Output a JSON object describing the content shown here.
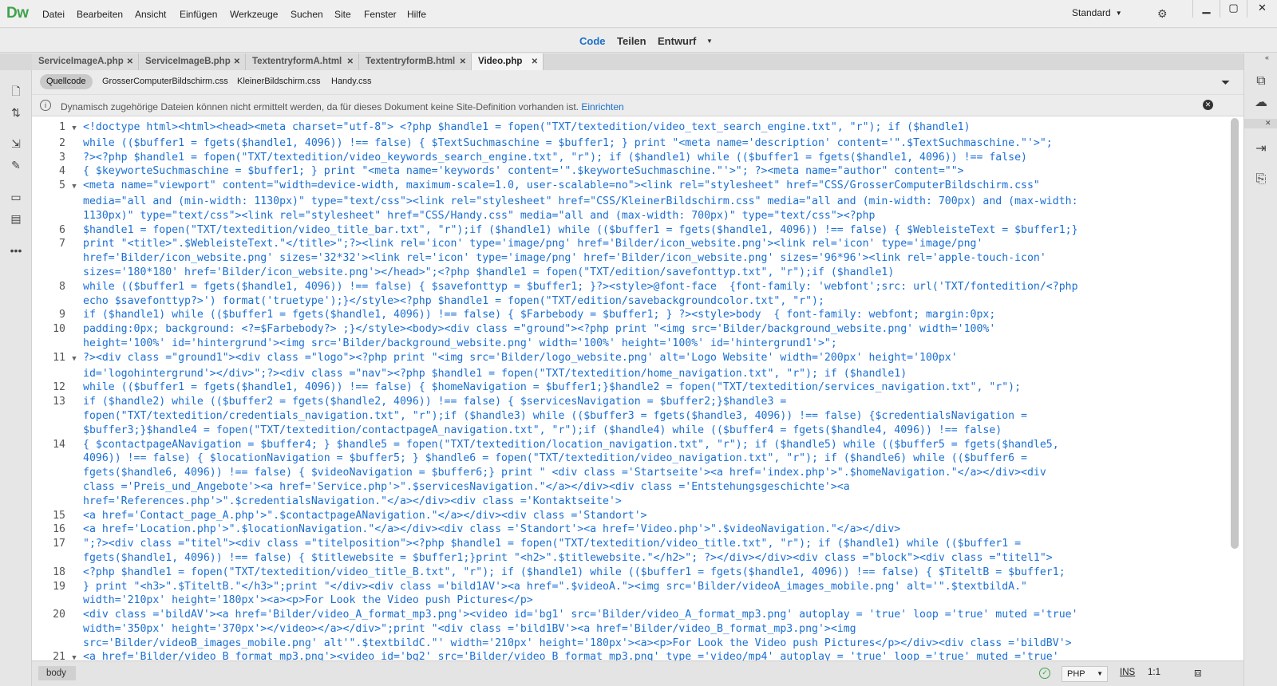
{
  "app": {
    "logo": "Dw"
  },
  "menu": [
    "Datei",
    "Bearbeiten",
    "Ansicht",
    "Einfügen",
    "Werkzeuge",
    "Suchen",
    "Site",
    "Fenster",
    "Hilfe"
  ],
  "workspace": {
    "label": "Standard"
  },
  "window_controls": {
    "minimize": "▁",
    "maximize": "▢",
    "close": "✕"
  },
  "views": {
    "code": "Code",
    "split": "Teilen",
    "design": "Entwurf"
  },
  "doc_tabs": [
    "ServiceImageA.php",
    "ServiceImageB.php",
    "TextentryformA.html",
    "TextentryformB.html",
    "Video.php"
  ],
  "related_files": {
    "source": "Quellcode",
    "files": [
      "GrosserComputerBildschirm.css",
      "KleinerBildschirm.css",
      "Handy.css"
    ]
  },
  "info": {
    "text": "Dynamisch zugehörige Dateien können nicht ermittelt werden, da für dieses Dokument keine Site-Definition vorhanden ist.",
    "link": "Einrichten"
  },
  "code_lines": [
    {
      "n": "1",
      "fold": true,
      "text": "<!doctype html><html><head><meta charset=\"utf-8\"> <?php $handle1 = fopen(\"TXT/textedition/video_text_search_engine.txt\", \"r\"); if ($handle1)"
    },
    {
      "n": "2",
      "fold": false,
      "text": "while (($buffer1 = fgets($handle1, 4096)) !== false) { $TextSuchmaschine = $buffer1; } print \"<meta name='description' content='\".$TextSuchmaschine.\"'>\";"
    },
    {
      "n": "3",
      "fold": false,
      "text": "?><?php $handle1 = fopen(\"TXT/textedition/video_keywords_search_engine.txt\", \"r\"); if ($handle1) while (($buffer1 = fgets($handle1, 4096)) !== false)"
    },
    {
      "n": "4",
      "fold": false,
      "text": "{ $keyworteSuchmaschine = $buffer1; } print \"<meta name='keywords' content='\".$keyworteSuchmaschine.\"'>\"; ?><meta name=\"author\" content=\"\">"
    },
    {
      "n": "5",
      "fold": true,
      "text": "<meta name=\"viewport\" content=\"width=device-width, maximum-scale=1.0, user-scalable=no\"><link rel=\"stylesheet\" href=\"CSS/GrosserComputerBildschirm.css\""
    },
    {
      "n": "",
      "fold": false,
      "text": "media=\"all and (min-width: 1130px)\" type=\"text/css\"><link rel=\"stylesheet\" href=\"CSS/KleinerBildschirm.css\" media=\"all and (min-width: 700px) and (max-width:"
    },
    {
      "n": "",
      "fold": false,
      "text": "1130px)\" type=\"text/css\"><link rel=\"stylesheet\" href=\"CSS/Handy.css\" media=\"all and (max-width: 700px)\" type=\"text/css\"><?php"
    },
    {
      "n": "6",
      "fold": false,
      "text": "$handle1 = fopen(\"TXT/textedition/video_title_bar.txt\", \"r\");if ($handle1) while (($buffer1 = fgets($handle1, 4096)) !== false) { $WebleisteText = $buffer1;}"
    },
    {
      "n": "7",
      "fold": false,
      "text": "print \"<title>\".$WebleisteText.\"</title>\";?><link rel='icon' type='image/png' href='Bilder/icon_website.png'><link rel='icon' type='image/png'"
    },
    {
      "n": "",
      "fold": false,
      "text": "href='Bilder/icon_website.png' sizes='32*32'><link rel='icon' type='image/png' href='Bilder/icon_website.png' sizes='96*96'><link rel='apple-touch-icon'"
    },
    {
      "n": "",
      "fold": false,
      "text": "sizes='180*180' href='Bilder/icon_website.png'></head>\";<?php $handle1 = fopen(\"TXT/edition/savefonttyp.txt\", \"r\");if ($handle1)"
    },
    {
      "n": "8",
      "fold": false,
      "text": "while (($buffer1 = fgets($handle1, 4096)) !== false) { $savefonttyp = $buffer1; }?><style>@font-face  {font-family: 'webfont';src: url('TXT/fontedition/<?php"
    },
    {
      "n": "",
      "fold": false,
      "text": "echo $savefonttyp?>') format('truetype');}</style><?php $handle1 = fopen(\"TXT/edition/savebackgroundcolor.txt\", \"r\");"
    },
    {
      "n": "9",
      "fold": false,
      "text": "if ($handle1) while (($buffer1 = fgets($handle1, 4096)) !== false) { $Farbebody = $buffer1; } ?><style>body  { font-family: webfont; margin:0px;"
    },
    {
      "n": "10",
      "fold": false,
      "text": "padding:0px; background: <?=$Farbebody?> ;}</style><body><div class =\"ground\"><?php print \"<img src='Bilder/background_website.png' width='100%'"
    },
    {
      "n": "",
      "fold": false,
      "text": "height='100%' id='hintergrund'><img src='Bilder/background_website.png' width='100%' height='100%' id='hintergrund1'>\";"
    },
    {
      "n": "11",
      "fold": true,
      "text": "?><div class =\"ground1\"><div class =\"logo\"><?php print \"<img src='Bilder/logo_website.png' alt='Logo Website' width='200px' height='100px'"
    },
    {
      "n": "",
      "fold": false,
      "text": "id='logohintergrund'></div>\";?><div class =\"nav\"><?php $handle1 = fopen(\"TXT/textedition/home_navigation.txt\", \"r\"); if ($handle1)"
    },
    {
      "n": "12",
      "fold": false,
      "text": "while (($buffer1 = fgets($handle1, 4096)) !== false) { $homeNavigation = $buffer1;}$handle2 = fopen(\"TXT/textedition/services_navigation.txt\", \"r\");"
    },
    {
      "n": "13",
      "fold": false,
      "text": "if ($handle2) while (($buffer2 = fgets($handle2, 4096)) !== false) { $servicesNavigation = $buffer2;}$handle3 ="
    },
    {
      "n": "",
      "fold": false,
      "text": "fopen(\"TXT/textedition/credentials_navigation.txt\", \"r\");if ($handle3) while (($buffer3 = fgets($handle3, 4096)) !== false) {$credentialsNavigation ="
    },
    {
      "n": "",
      "fold": false,
      "text": "$buffer3;}$handle4 = fopen(\"TXT/textedition/contactpageA_navigation.txt\", \"r\");if ($handle4) while (($buffer4 = fgets($handle4, 4096)) !== false)"
    },
    {
      "n": "14",
      "fold": false,
      "text": "{ $contactpageANavigation = $buffer4; } $handle5 = fopen(\"TXT/textedition/location_navigation.txt\", \"r\"); if ($handle5) while (($buffer5 = fgets($handle5,"
    },
    {
      "n": "",
      "fold": false,
      "text": "4096)) !== false) { $locationNavigation = $buffer5; } $handle6 = fopen(\"TXT/textedition/video_navigation.txt\", \"r\"); if ($handle6) while (($buffer6 ="
    },
    {
      "n": "",
      "fold": false,
      "text": "fgets($handle6, 4096)) !== false) { $videoNavigation = $buffer6;} print \" <div class ='Startseite'><a href='index.php'>\".$homeNavigation.\"</a></div><div"
    },
    {
      "n": "",
      "fold": false,
      "text": "class ='Preis_und_Angebote'><a href='Service.php'>\".$servicesNavigation.\"</a></div><div class ='Entstehungsgeschichte'><a"
    },
    {
      "n": "",
      "fold": false,
      "text": "href='References.php'>\".$credentialsNavigation.\"</a></div><div class ='Kontaktseite'>"
    },
    {
      "n": "15",
      "fold": false,
      "text": "<a href='Contact_page_A.php'>\".$contactpageANavigation.\"</a></div><div class ='Standort'>"
    },
    {
      "n": "16",
      "fold": false,
      "text": "<a href='Location.php'>\".$locationNavigation.\"</a></div><div class ='Standort'><a href='Video.php'>\".$videoNavigation.\"</a></div>"
    },
    {
      "n": "17",
      "fold": false,
      "text": "\";?><div class =\"titel\"><div class =\"titelposition\"><?php $handle1 = fopen(\"TXT/textedition/video_title.txt\", \"r\"); if ($handle1) while (($buffer1 ="
    },
    {
      "n": "",
      "fold": false,
      "text": "fgets($handle1, 4096)) !== false) { $titlewebsite = $buffer1;}print \"<h2>\".$titlewebsite.\"</h2>\"; ?></div></div><div class =\"block\"><div class =\"titel1\">"
    },
    {
      "n": "18",
      "fold": false,
      "text": "<?php $handle1 = fopen(\"TXT/textedition/video_title_B.txt\", \"r\"); if ($handle1) while (($buffer1 = fgets($handle1, 4096)) !== false) { $TiteltB = $buffer1;"
    },
    {
      "n": "19",
      "fold": false,
      "text": "} print \"<h3>\".$TiteltB.\"</h3>\";print \"</div><div class ='bild1AV'><a href=\".$videoA.\"><img src='Bilder/videoA_images_mobile.png' alt='\".$textbildA.\""
    },
    {
      "n": "",
      "fold": false,
      "text": "width='210px' height='180px'><a><p>For Look the Video push Pictures</p>"
    },
    {
      "n": "20",
      "fold": false,
      "text": "<div class ='bildAV'><a href='Bilder/video_A_format_mp3.png'><video id='bg1' src='Bilder/video_A_format_mp3.png' autoplay = 'true' loop ='true' muted ='true'"
    },
    {
      "n": "",
      "fold": false,
      "text": "width='350px' height='370px'></video></a></div>\";print \"<div class ='bild1BV'><a href='Bilder/video_B_format_mp3.png'><img"
    },
    {
      "n": "",
      "fold": false,
      "text": "src='Bilder/videoB_images_mobile.png' alt'\".$textbildC.\"' width='210px' height='180px'><a><p>For Look the Video push Pictures</p></div><div class ='bildBV'>"
    },
    {
      "n": "21",
      "fold": true,
      "text": "<a href='Bilder/video_B_format_mp3.png'><video id='bg2' src='Bilder/video_B_format_mp3.png' type ='video/mp4' autoplay = 'true' loop ='true' muted ='true'"
    }
  ],
  "status": {
    "tag": "body",
    "language": "PHP",
    "mode": "INS",
    "position": "1:1"
  },
  "colors": {
    "accent": "#1a6fc9",
    "code": "#1b6fd4",
    "logo": "#3fa34d"
  }
}
